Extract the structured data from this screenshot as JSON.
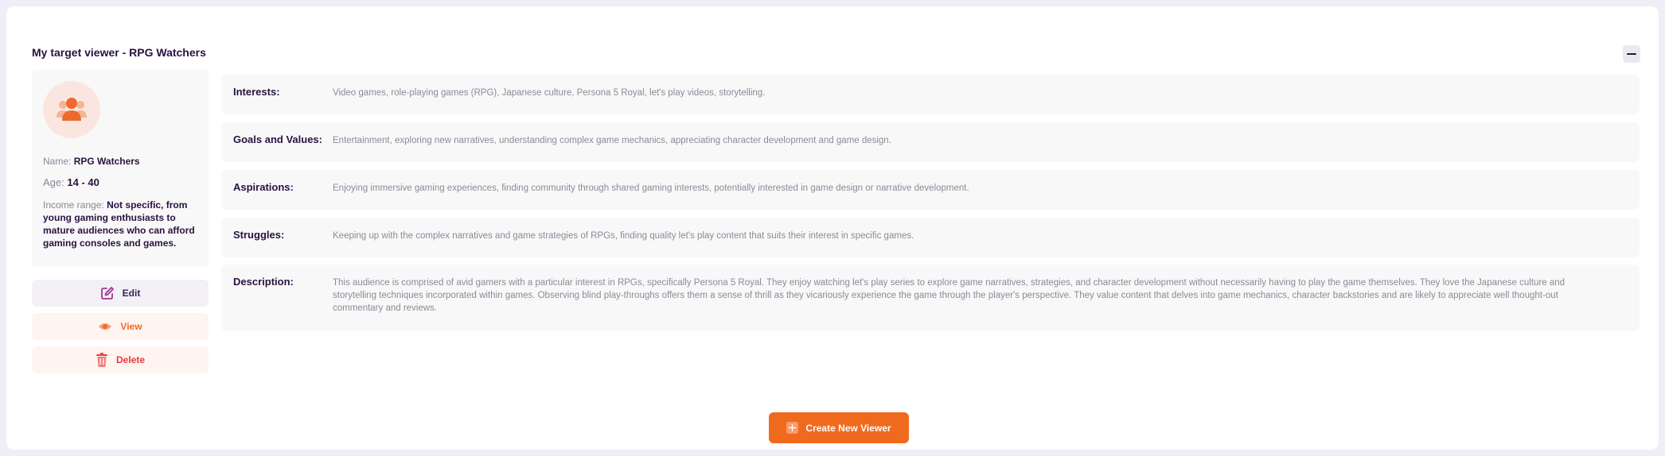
{
  "panel": {
    "title": "My target viewer - RPG Watchers"
  },
  "profile": {
    "name_label": "Name:",
    "name_value": "RPG Watchers",
    "age_label": "Age:",
    "age_value": "14 - 40",
    "income_label": "Income range:",
    "income_value": "Not specific, from young gaming enthusiasts to mature audiences who can afford gaming consoles and games."
  },
  "actions": {
    "edit": "Edit",
    "view": "View",
    "delete": "Delete"
  },
  "details": [
    {
      "label": "Interests:",
      "value": "Video games, role-playing games (RPG), Japanese culture, Persona 5 Royal, let's play videos, storytelling."
    },
    {
      "label": "Goals and Values:",
      "value": "Entertainment, exploring new narratives, understanding complex game mechanics, appreciating character development and game design."
    },
    {
      "label": "Aspirations:",
      "value": "Enjoying immersive gaming experiences, finding community through shared gaming interests, potentially interested in game design or narrative development."
    },
    {
      "label": "Struggles:",
      "value": "Keeping up with the complex narratives and game strategies of RPGs, finding quality let's play content that suits their interest in specific games."
    },
    {
      "label": "Description:",
      "value": "This audience is comprised of avid gamers with a particular interest in RPGs, specifically Persona 5 Royal. They enjoy watching let's play series to explore game narratives, strategies, and character development without necessarily having to play the game themselves. They love the Japanese culture and storytelling techniques incorporated within games. Observing blind play-throughs offers them a sense of thrill as they vicariously experience the game through the player's perspective. They value content that delves into game mechanics, character backstories and are likely to appreciate well thought-out commentary and reviews."
    }
  ],
  "footer": {
    "create_label": "Create New Viewer"
  },
  "icons": {
    "avatar": "audience-group-icon",
    "collapse": "minus-icon",
    "edit": "edit-pencil-icon",
    "view": "eye-icon",
    "delete": "trash-icon",
    "create": "plus-icon"
  },
  "colors": {
    "accent": "#f06a1e",
    "heading": "#2a1240",
    "danger": "#e63a3a"
  }
}
